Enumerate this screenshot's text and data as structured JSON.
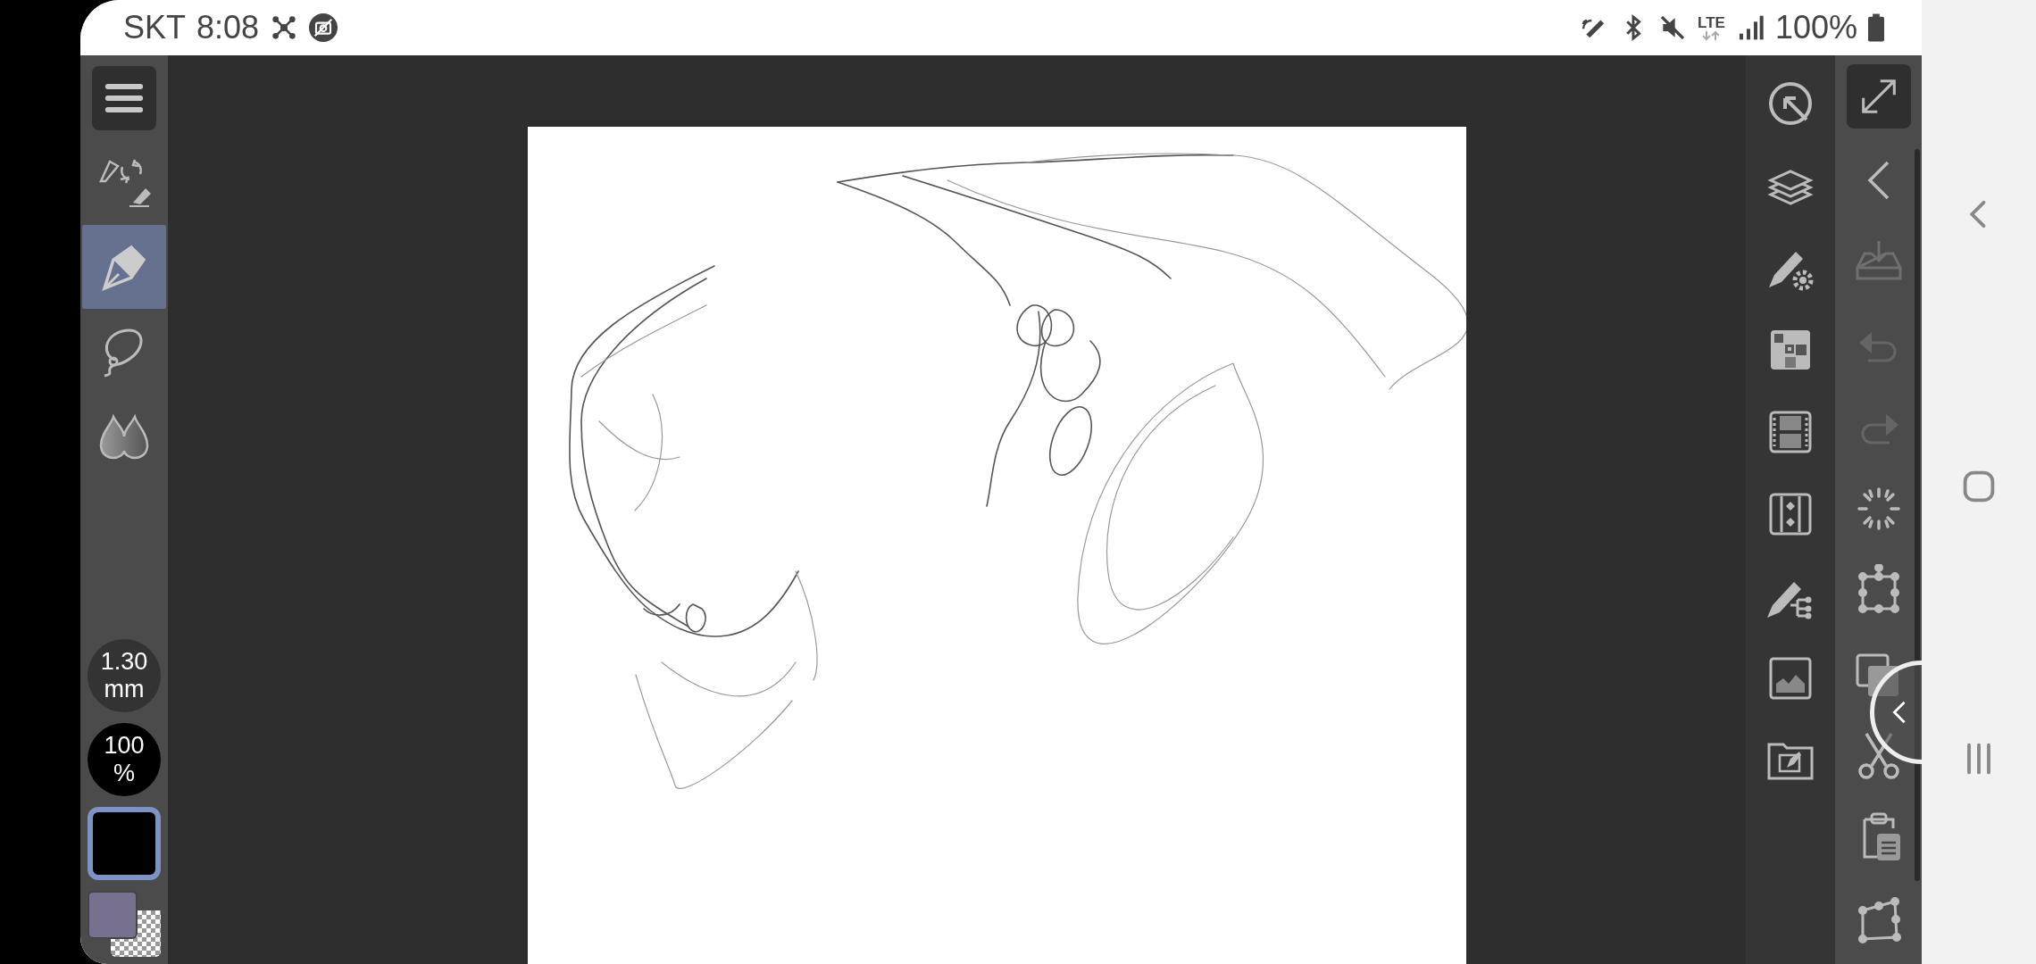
{
  "status_bar": {
    "carrier": "SKT",
    "time": "8:08",
    "network": "LTE",
    "battery": "100%"
  },
  "left_toolbar": {
    "tools": [
      {
        "kind": "pen",
        "selected": true
      },
      {
        "kind": "lasso",
        "selected": false
      },
      {
        "kind": "blend",
        "selected": false
      }
    ],
    "brush_size": {
      "value": "1.30",
      "unit": "mm"
    },
    "opacity": {
      "value": "100",
      "unit": "%"
    },
    "colors": [
      {
        "color": "#000000",
        "selected": true
      },
      {
        "color": "#77708f",
        "selected": false
      }
    ]
  },
  "palette_bar": [
    {
      "kind": "navigator"
    },
    {
      "kind": "layers"
    },
    {
      "kind": "tool-settings"
    },
    {
      "kind": "color-set"
    },
    {
      "kind": "animation"
    },
    {
      "kind": "timeline"
    },
    {
      "kind": "sub-tool"
    },
    {
      "kind": "material"
    },
    {
      "kind": "file"
    }
  ],
  "command_bar": [
    {
      "kind": "fullscreen",
      "disabled": false
    },
    {
      "kind": "back",
      "disabled": false
    },
    {
      "kind": "save",
      "disabled": true
    },
    {
      "kind": "undo",
      "disabled": true
    },
    {
      "kind": "redo",
      "disabled": true
    },
    {
      "kind": "loading",
      "disabled": false
    },
    {
      "kind": "transform",
      "disabled": false
    },
    {
      "kind": "copy",
      "disabled": false
    },
    {
      "kind": "cut",
      "disabled": false
    },
    {
      "kind": "paste",
      "disabled": false
    },
    {
      "kind": "free-transform",
      "disabled": false
    }
  ]
}
